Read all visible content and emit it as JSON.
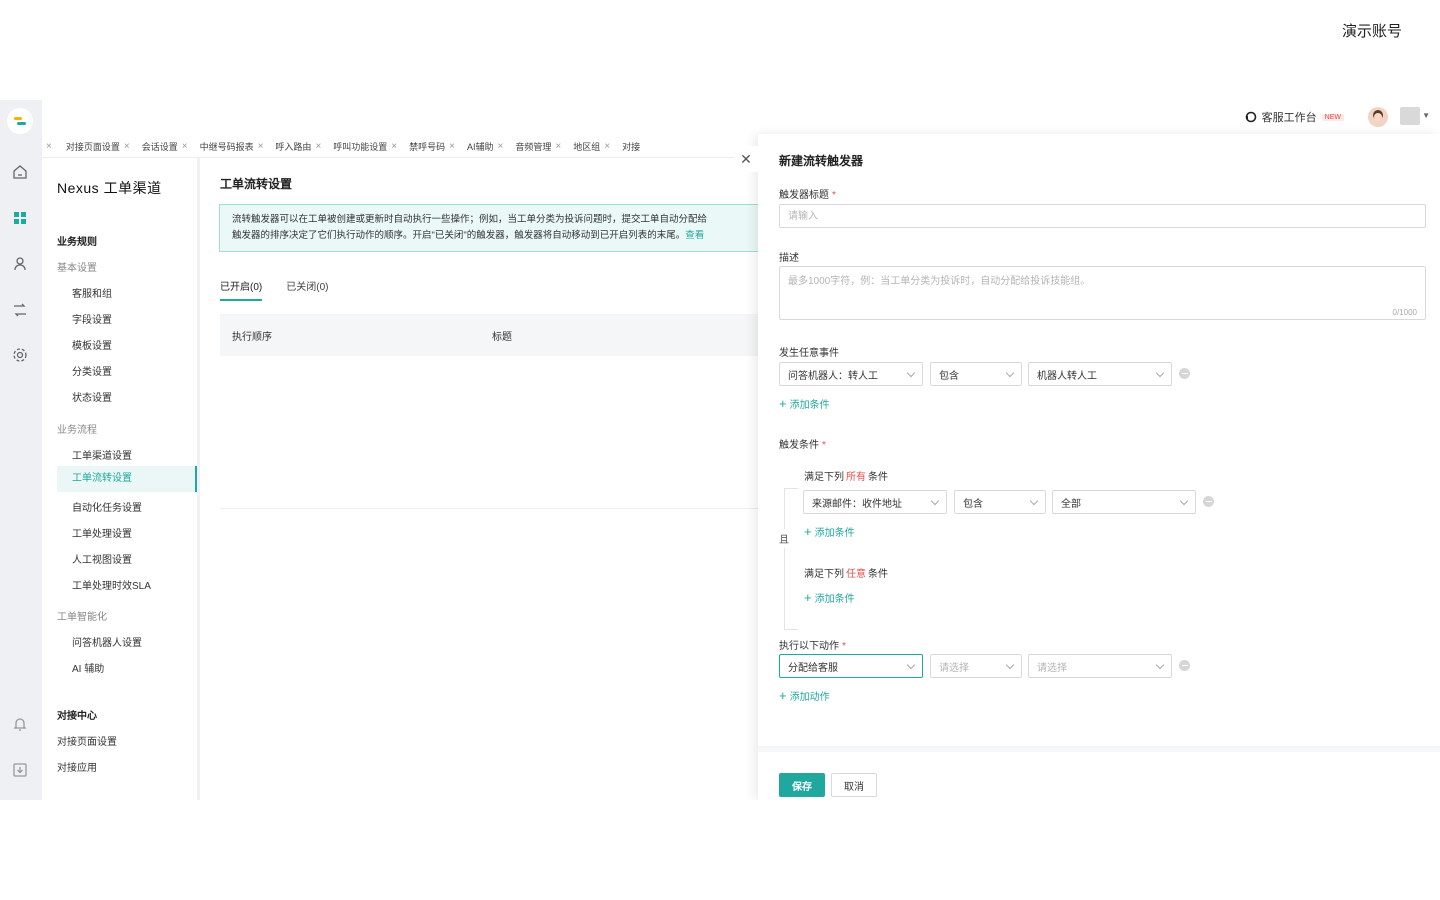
{
  "account": "演示账号",
  "topbar": {
    "workspace": "客服工作台",
    "new_badge": "NEW"
  },
  "tabs": [
    {
      "label": "对接页面设置"
    },
    {
      "label": "会话设置"
    },
    {
      "label": "中继号码报表"
    },
    {
      "label": "呼入路由"
    },
    {
      "label": "呼叫功能设置"
    },
    {
      "label": "禁呼号码"
    },
    {
      "label": "AI辅助"
    },
    {
      "label": "音频管理"
    },
    {
      "label": "地区组"
    },
    {
      "label": "对接"
    }
  ],
  "sidebar": {
    "brand": "Nexus 工单渠道",
    "section1": "业务规则",
    "group_basic": "基本设置",
    "basic_items": [
      "客服和组",
      "字段设置",
      "模板设置",
      "分类设置",
      "状态设置"
    ],
    "group_flow": "业务流程",
    "flow_items": [
      "工单渠道设置",
      "工单流转设置",
      "自动化任务设置",
      "工单处理设置",
      "人工视图设置",
      "工单处理时效SLA"
    ],
    "group_ai": "工单智能化",
    "ai_items": [
      "问答机器人设置",
      "AI 辅助"
    ],
    "section2": "对接中心",
    "dock_items": [
      "对接页面设置",
      "对接应用"
    ]
  },
  "main": {
    "title": "工单流转设置",
    "notice_line1": "流转触发器可以在工单被创建或更新时自动执行一些操作；例如，当工单分类为投诉问题时，提交工单自动分配给",
    "notice_line2": "触发器的排序决定了它们执行动作的顺序。开启\"已关闭\"的触发器，触发器将自动移动到已开启列表的末尾。",
    "notice_link": "查看",
    "tab_open": "已开启(0)",
    "tab_closed": "已关闭(0)",
    "col_order": "执行顺序",
    "col_title": "标题"
  },
  "drawer": {
    "title": "新建流转触发器",
    "title_label": "触发器标题",
    "title_placeholder": "请输入",
    "desc_label": "描述",
    "desc_placeholder": "最多1000字符，例：当工单分类为投诉时，自动分配给投诉技能组。",
    "desc_counter": "0/1000",
    "event_label": "发生任意事件",
    "event_field": "问答机器人：转人工",
    "event_op": "包含",
    "event_value": "机器人转人工",
    "add_condition": "添加条件",
    "cond_label": "触发条件",
    "all_prefix": "满足下列",
    "all_word": "所有",
    "suffix": "条件",
    "all_field": "来源邮件：收件地址",
    "all_op": "包含",
    "all_value": "全部",
    "and_label": "且",
    "any_word": "任意",
    "action_label": "执行以下动作",
    "action_field": "分配给客服",
    "action_op": "请选择",
    "action_value": "请选择",
    "add_action": "添加动作",
    "save": "保存",
    "cancel": "取消"
  }
}
